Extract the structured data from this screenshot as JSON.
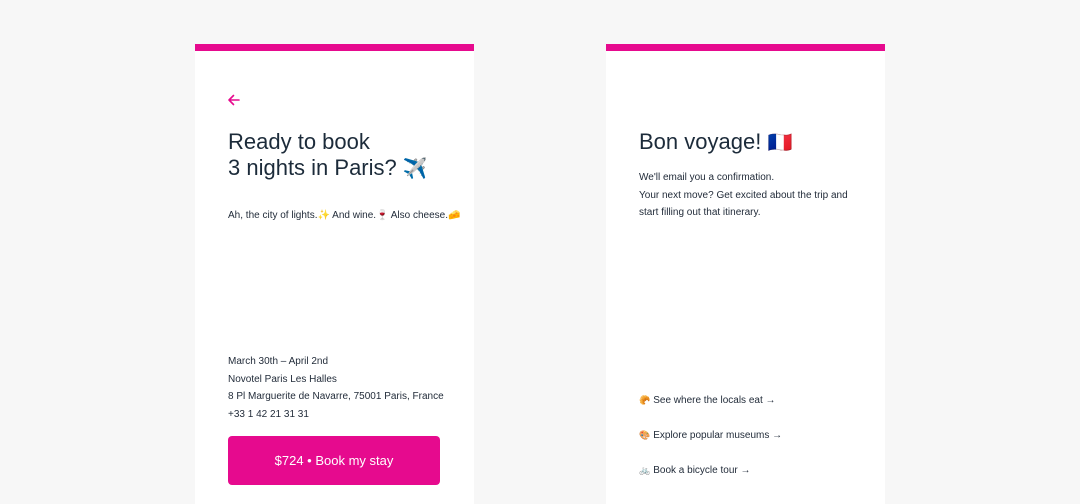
{
  "booking_card": {
    "title_line1": "Ready to book",
    "title_line2": "3 nights in Paris?",
    "title_emoji": "✈️",
    "tagline": "Ah, the city of lights.✨ And wine.🍷 Also cheese.🧀",
    "dates": "March 30th – April 2nd",
    "hotel": "Novotel Paris Les Halles",
    "address": "8 Pl Marguerite de Navarre, 75001 Paris, France",
    "phone": "+33 1 42 21 31 31",
    "book_button": "$724 • Book my stay"
  },
  "confirmation_card": {
    "title": "Bon voyage!",
    "title_emoji": "🇫🇷",
    "line1": "We'll email you a confirmation.",
    "line2": "Your next move? Get excited about the trip and",
    "line3": "start filling out that itinerary.",
    "links": [
      {
        "emoji": "🥐",
        "label": "See where the locals eat →"
      },
      {
        "emoji": "🎨",
        "label": "Explore popular museums →"
      },
      {
        "emoji": "🚲",
        "label": "Book a bicycle tour →"
      }
    ]
  },
  "colors": {
    "accent": "#e60a8e",
    "background": "#f7f7f7",
    "card": "#ffffff",
    "title_text": "#1c2b3a"
  },
  "icons": {
    "back": "arrow-left-icon"
  }
}
